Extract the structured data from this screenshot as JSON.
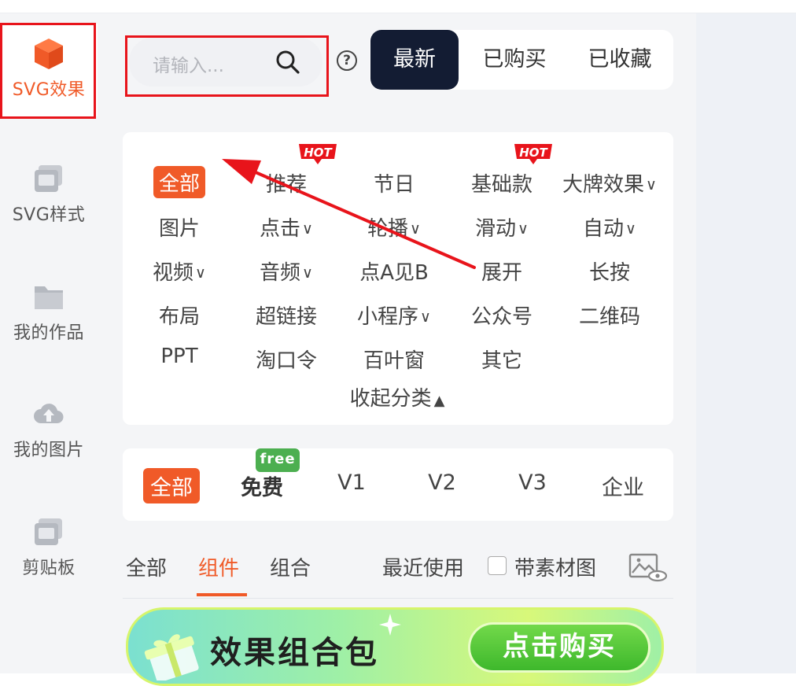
{
  "sidebar": {
    "items": [
      {
        "label": "SVG效果",
        "icon": "cube-icon",
        "active": true
      },
      {
        "label": "SVG样式",
        "icon": "window-icon"
      },
      {
        "label": "我的作品",
        "icon": "folder-icon"
      },
      {
        "label": "我的图片",
        "icon": "cloud-upload-icon"
      },
      {
        "label": "剪贴板",
        "icon": "window-icon"
      }
    ]
  },
  "search": {
    "placeholder": "请输入..."
  },
  "help": {
    "label": "?"
  },
  "top_tabs": [
    "最新",
    "已购买",
    "已收藏"
  ],
  "categories": {
    "row1": [
      "全部",
      "推荐",
      "节日",
      "基础款",
      "大牌效果"
    ],
    "row2": [
      "图片",
      "点击",
      "轮播",
      "滑动",
      "自动"
    ],
    "row3": [
      "视频",
      "音频",
      "点A见B",
      "展开",
      "长按"
    ],
    "row4": [
      "布局",
      "超链接",
      "小程序",
      "公众号",
      "二维码"
    ],
    "row5": [
      "PPT",
      "淘口令",
      "百叶窗",
      "其它"
    ],
    "collapse": "收起分类",
    "hot_badge": "HOT"
  },
  "versions": [
    "全部",
    "免费",
    "V1",
    "V2",
    "V3",
    "企业"
  ],
  "free_badge": "free",
  "sub_tabs": {
    "all": "全部",
    "component": "组件",
    "combo": "组合",
    "recent": "最近使用",
    "with_material": "带素材图"
  },
  "banner": {
    "title": "效果组合包",
    "button": "点击购买"
  },
  "colors": {
    "accent": "#f05a28",
    "dark": "#131c33",
    "annotation": "#e8141b",
    "green": "#4caf50"
  }
}
